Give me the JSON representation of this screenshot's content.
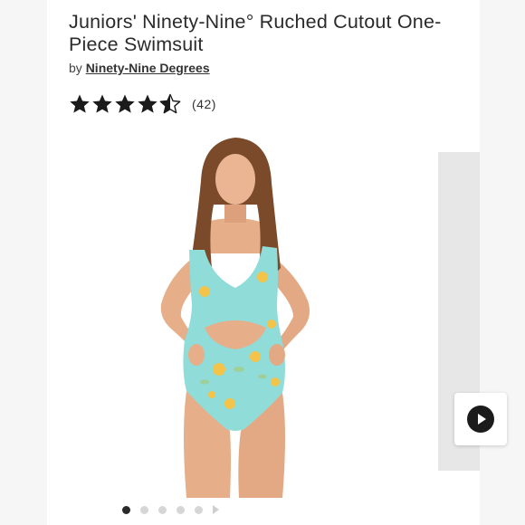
{
  "product": {
    "title": "Juniors' Ninety-Nine° Ruched Cutout One-Piece Swimsuit",
    "by_prefix": "by",
    "brand": "Ninety-Nine Degrees",
    "rating": 4.5,
    "review_count": "(42)"
  },
  "gallery": {
    "image_count": 5,
    "active_index": 0
  },
  "colors": {
    "star": "#1b1b1b",
    "swimsuit": "#8fdcd8",
    "flower": "#f4c34a"
  }
}
